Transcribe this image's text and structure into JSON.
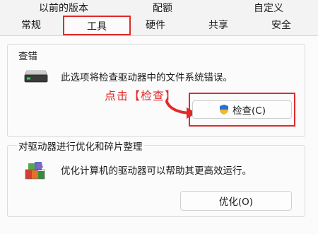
{
  "tabs_top": [
    {
      "label": "以前的版本"
    },
    {
      "label": "配额"
    },
    {
      "label": "自定义"
    }
  ],
  "tabs_bottom": [
    {
      "label": "常规"
    },
    {
      "label": "工具"
    },
    {
      "label": "硬件"
    },
    {
      "label": "共享"
    },
    {
      "label": "安全"
    }
  ],
  "active_tab": "工具",
  "check_group": {
    "title": "查错",
    "description": "此选项将检查驱动器中的文件系统错误。",
    "button_label": "检查(C)",
    "icon": "drive-icon",
    "button_icon": "uac-shield-icon"
  },
  "optimize_group": {
    "title": "对驱动器进行优化和碎片整理",
    "description": "优化计算机的驱动器可以帮助其更高效运行。",
    "button_label": "优化(O)",
    "icon": "defrag-icon"
  },
  "annotation": {
    "text": "点击【检查】",
    "color": "#e02a2a"
  },
  "colors": {
    "highlight": "#e02a2a",
    "panel_bg": "#fbfbfb",
    "window_bg": "#f3f3f3"
  }
}
